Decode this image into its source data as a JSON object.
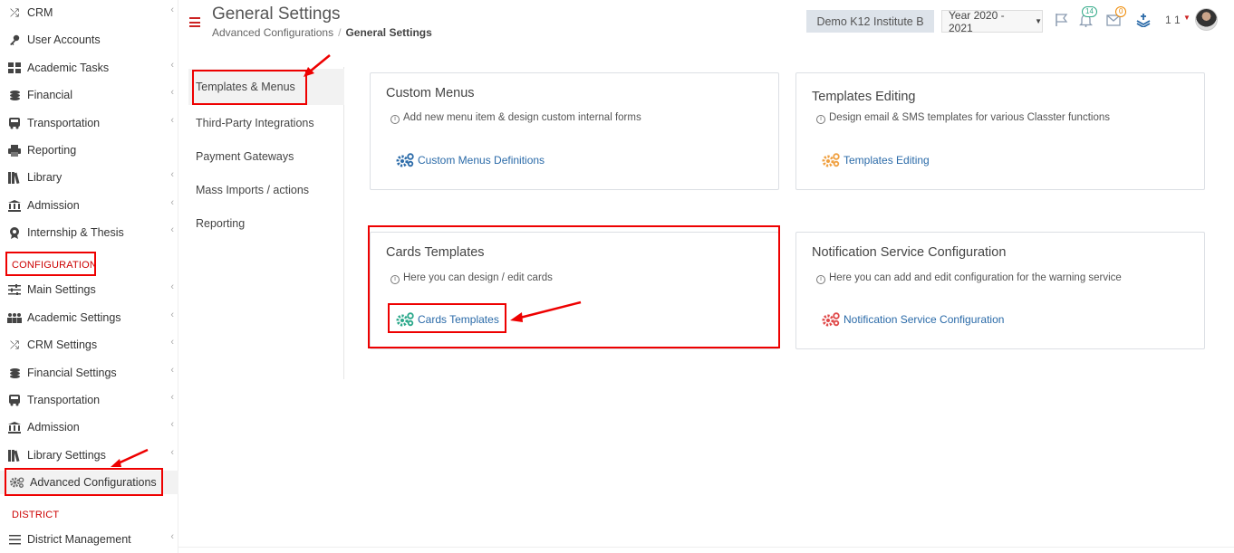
{
  "sidebar": {
    "items": [
      {
        "label": "CRM",
        "icon": "shuffle-icon",
        "chevron": true
      },
      {
        "label": "User Accounts",
        "icon": "key-icon",
        "chevron": false
      },
      {
        "label": "Academic Tasks",
        "icon": "grid-icon",
        "chevron": true
      },
      {
        "label": "Financial",
        "icon": "coins-icon",
        "chevron": true
      },
      {
        "label": "Transportation",
        "icon": "bus-icon",
        "chevron": true
      },
      {
        "label": "Reporting",
        "icon": "printer-icon",
        "chevron": false
      },
      {
        "label": "Library",
        "icon": "books-icon",
        "chevron": true
      },
      {
        "label": "Admission",
        "icon": "institution-icon",
        "chevron": true
      },
      {
        "label": "Internship & Thesis",
        "icon": "certificate-icon",
        "chevron": true
      }
    ],
    "config_section": "CONFIGURATION",
    "config_items": [
      {
        "label": "Main Settings",
        "icon": "sliders-icon",
        "chevron": true
      },
      {
        "label": "Academic Settings",
        "icon": "users-icon",
        "chevron": true
      },
      {
        "label": "CRM Settings",
        "icon": "shuffle-icon",
        "chevron": true
      },
      {
        "label": "Financial Settings",
        "icon": "coins-icon",
        "chevron": true
      },
      {
        "label": "Transportation",
        "icon": "bus-icon",
        "chevron": true
      },
      {
        "label": "Admission",
        "icon": "institution-icon",
        "chevron": true
      },
      {
        "label": "Library Settings",
        "icon": "books-icon",
        "chevron": true
      },
      {
        "label": "Advanced Configurations",
        "icon": "gears-icon",
        "chevron": false
      }
    ],
    "district_section": "DISTRICT",
    "district_items": [
      {
        "label": "District Management",
        "icon": "list-icon",
        "chevron": true
      }
    ]
  },
  "header": {
    "title": "General Settings",
    "breadcrumb_parent": "Advanced Configurations",
    "breadcrumb_separator": "/",
    "breadcrumb_current": "General Settings",
    "institute": "Demo K12 Institute B",
    "year": "Year 2020 - 2021",
    "notifications_count": "14",
    "messages_count": "0",
    "user": "1 1"
  },
  "submenu": {
    "items": [
      "Templates & Menus",
      "Third-Party Integrations",
      "Payment Gateways",
      "Mass Imports / actions",
      "Reporting"
    ]
  },
  "cards": {
    "custom_menus": {
      "title": "Custom Menus",
      "desc": "Add new menu item & design custom internal forms",
      "link": "Custom Menus Definitions",
      "gear_color": "#2a6aa8"
    },
    "templates_editing": {
      "title": "Templates Editing",
      "desc": "Design email & SMS templates for various Classter functions",
      "link": "Templates Editing",
      "gear_color": "#f0a040"
    },
    "cards_templates": {
      "title": "Cards Templates",
      "desc": "Here you can design / edit cards",
      "link": "Cards Templates",
      "gear_color": "#2aa88a"
    },
    "notification_service": {
      "title": "Notification Service Configuration",
      "desc": "Here you can add and edit configuration for the warning service",
      "link": "Notification Service Configuration",
      "gear_color": "#e04848"
    }
  },
  "colors": {
    "highlight": "#e00000",
    "section_red": "#cc0000",
    "link_blue": "#2a6aa8"
  }
}
